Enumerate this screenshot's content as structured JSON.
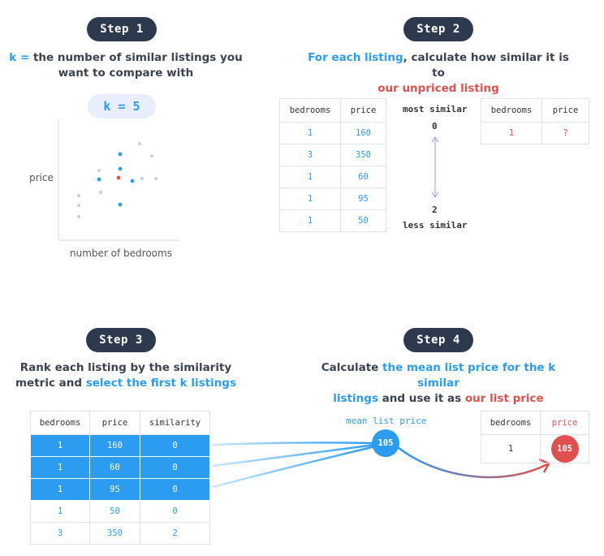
{
  "step1": {
    "pill": "Step 1",
    "k_text": "k =",
    "desc_line1": " the number of similar listings you",
    "desc_line2": "want to compare with",
    "k_pill": "k = 5",
    "y_axis": "price",
    "x_axis": "number of bedrooms"
  },
  "step2": {
    "pill": "Step 2",
    "desc_blue": "For each listing",
    "desc_rest": ", calculate how similar it is to",
    "desc_red": "our unpriced listing",
    "table_headers": [
      "bedrooms",
      "price"
    ],
    "rows": [
      [
        "1",
        "160"
      ],
      [
        "3",
        "350"
      ],
      [
        "1",
        "60"
      ],
      [
        "1",
        "95"
      ],
      [
        "1",
        "50"
      ]
    ],
    "most_similar": "most similar",
    "zero": "0",
    "two": "2",
    "less_similar": "less similar",
    "target_headers": [
      "bedrooms",
      "price"
    ],
    "target_row": [
      "1",
      "?"
    ]
  },
  "step3": {
    "pill": "Step 3",
    "desc_line1": "Rank each listing by the similarity",
    "desc_line2_a": "metric and ",
    "desc_line2_blue": "select the first k listings",
    "headers": [
      "bedrooms",
      "price",
      "similarity"
    ],
    "rows": [
      [
        "1",
        "160",
        "0"
      ],
      [
        "1",
        "60",
        "0"
      ],
      [
        "1",
        "95",
        "0"
      ],
      [
        "1",
        "50",
        "0"
      ],
      [
        "3",
        "350",
        "2"
      ]
    ]
  },
  "step4": {
    "pill": "Step 4",
    "desc_a": "Calculate ",
    "desc_blue1": "the mean list price for the k similar",
    "desc_blue2": "listings",
    "desc_b": " and use it as ",
    "desc_red": "our list price",
    "mean_label": "mean list price",
    "mean_value": "105",
    "headers": [
      "bedrooms",
      "price"
    ],
    "row": [
      "1",
      "105"
    ]
  },
  "colors": {
    "blue": "#2c9cf0",
    "red": "#e0504f",
    "dark": "#2d3a4e"
  }
}
